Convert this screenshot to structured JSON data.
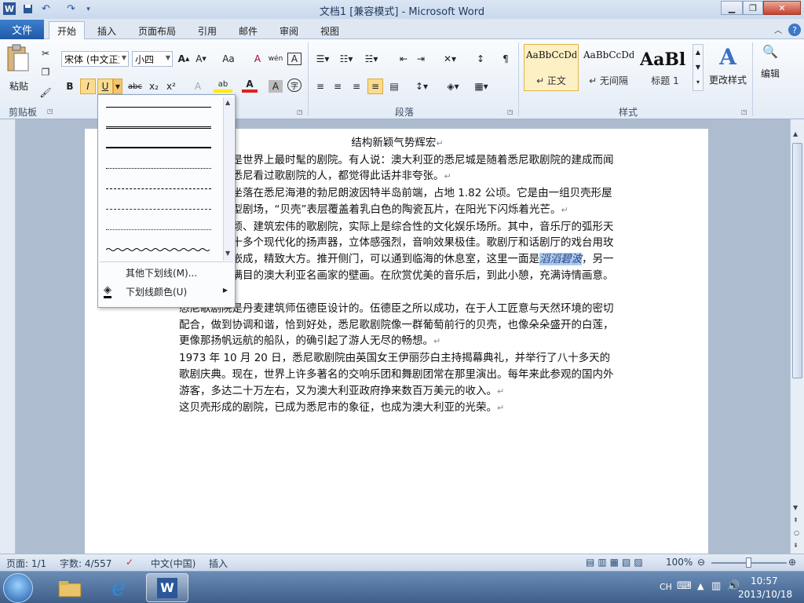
{
  "window": {
    "title": "文档1 [兼容模式] - Microsoft Word",
    "app_icon": "word-icon",
    "quick_access": [
      "save-icon",
      "undo-icon",
      "redo-icon",
      "customize-icon"
    ],
    "controls": {
      "minimize": "▁",
      "maximize": "❐",
      "close": "✕"
    }
  },
  "tabs": {
    "file": "文件",
    "items": [
      "开始",
      "插入",
      "页面布局",
      "引用",
      "邮件",
      "审阅",
      "视图"
    ],
    "active": "开始"
  },
  "ribbon": {
    "clipboard": {
      "label": "剪贴板",
      "paste": "粘贴"
    },
    "font": {
      "name": "宋体 (中文正文",
      "size": "小四",
      "bold": "B",
      "italic": "I",
      "underline": "U",
      "strike": "abc",
      "sub": "x₂",
      "sup": "x²",
      "grow": "A",
      "shrink": "A",
      "case": "Aa",
      "clear": "A",
      "phonetic": "wén",
      "border_char": "A",
      "highlight": "ab",
      "font_color": "A",
      "shade": "A",
      "enclose": "字"
    },
    "paragraph": {
      "label": "段落"
    },
    "styles": {
      "label": "样式",
      "items": [
        {
          "preview": "AaBbCcDd",
          "name": "↵ 正文"
        },
        {
          "preview": "AaBbCcDd",
          "name": "↵ 无间隔"
        },
        {
          "preview": "AaBl",
          "name": "标题 1"
        }
      ],
      "change": "更改样式"
    },
    "editing": {
      "label": "编辑"
    }
  },
  "underline_menu": {
    "styles": [
      "single",
      "double",
      "thick",
      "dotted",
      "dashed",
      "dash-dot",
      "dash-dot-dot",
      "wave"
    ],
    "more": "其他下划线(M)...",
    "color": "下划线颜色(U)"
  },
  "document": {
    "title": "结构新颖气势辉宏",
    "paragraphs": [
      "悉尼歌剧院是世界上最时髦的剧院。有人说：澳大利亚的悉尼城是随着悉尼歌剧院的建成而闻名的，没去悉尼看过歌剧院的人，都觉得此话并非夸张。",
      "悉尼歌剧院坐落在悉尼海港的勃尼朗波因特半岛前端，占地 1.82 公顷。它是由一组贝壳形屋顶组成的大型剧场，“贝壳”表层覆盖着乳白色的陶瓷瓦片，在阳光下闪烁着光芒。",
      "这座结构新颖、建筑宏伟的歌剧院，实际上是综合性的文化娱乐场所。其中，音乐厅的弧形天花板装有二十多个现代化的扬声器，立体感强烈，音响效果极佳。歌剧厅和话剧厅的戏台用玫瑰形的木块嵌成，精致大方。推开侧门，可以通到临海的休息室，这里一面是",
      "滔滔碧波",
      "，另一面却是琳琅满目的澳大利亚名画家的壁画。在欣赏优美的音乐后，到此小憩，充满诗情画意。",
      "悉尼歌剧院是丹麦建筑师伍德臣设计的。伍德臣之所以成功，在于人工匠意与天然环境的密切配合，做到协调和谐，恰到好处，悉尼歌剧院像一群葡萄前行的贝壳，也像朵朵盛开的白莲，更像那扬帆远航的船队，的确引起了游人无尽的畅想。",
      "1973 年 10 月 20 日，悉尼歌剧院由英国女王伊丽莎白主持揭幕典礼，并举行了八十多天的歌剧庆典。现在，世界上许多著名的交响乐团和舞剧团常在那里演出。每年来此参观的国内外游客，多达二十万左右，又为澳大利亚政府挣来数百万美元的收入。",
      "这贝壳形成的剧院，已成为悉尼市的象征，也成为澳大利亚的光荣。"
    ]
  },
  "status": {
    "page": "页面: 1/1",
    "words": "字数: 4/557",
    "lang": "中文(中国)",
    "mode": "插入",
    "zoom": "100%"
  },
  "taskbar": {
    "items": [
      "start-orb",
      "explorer-icon",
      "ie-icon",
      "word-icon"
    ],
    "ime": "CH",
    "time": "10:57",
    "date": "2013/10/18"
  },
  "colors": {
    "accent": "#2b579a",
    "file_tab": "#2a66b8",
    "highlight": "#aecbec"
  }
}
